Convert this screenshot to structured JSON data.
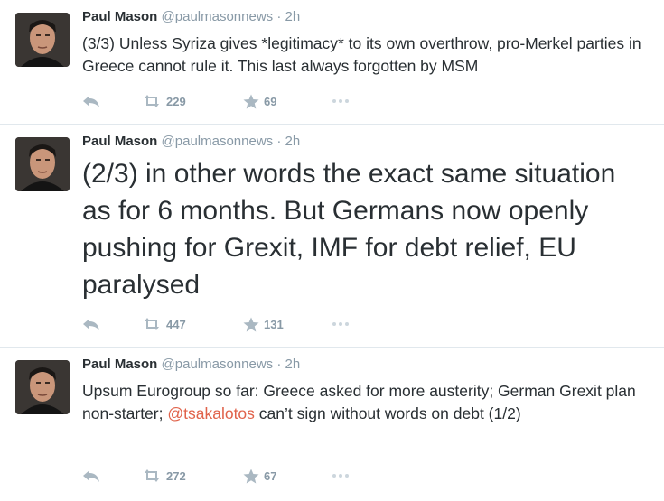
{
  "colors": {
    "text": "#292f33",
    "muted": "#8899a6",
    "mention": "#e0624a",
    "divider": "#e1e8ed"
  },
  "tweets": [
    {
      "author": "Paul Mason",
      "handle": "@paulmasonnews",
      "separator": "·",
      "time": "2h",
      "text": "(3/3) Unless Syriza gives *legitimacy* to its own overthrow, pro-Merkel parties in Greece cannot rule it. This last always forgotten by MSM",
      "retweets": "229",
      "favorites": "69",
      "icons": [
        "reply-icon",
        "retweet-icon",
        "favorite-icon",
        "more-icon"
      ]
    },
    {
      "author": "Paul Mason",
      "handle": "@paulmasonnews",
      "separator": "·",
      "time": "2h",
      "text": "(2/3) in other words the exact same situation as for 6 months. But Germans now openly pushing for Grexit, IMF for debt relief, EU paralysed",
      "retweets": "447",
      "favorites": "131",
      "icons": [
        "reply-icon",
        "retweet-icon",
        "favorite-icon",
        "more-icon"
      ]
    },
    {
      "author": "Paul Mason",
      "handle": "@paulmasonnews",
      "separator": "·",
      "time": "2h",
      "text_before": "Upsum Eurogroup so far: Greece asked for more austerity; German Grexit plan non-starter; ",
      "mention": "@tsakalotos",
      "text_after": " can’t sign without words on debt (1/2)",
      "retweets": "272",
      "favorites": "67",
      "icons": [
        "reply-icon",
        "retweet-icon",
        "favorite-icon",
        "more-icon"
      ]
    }
  ]
}
